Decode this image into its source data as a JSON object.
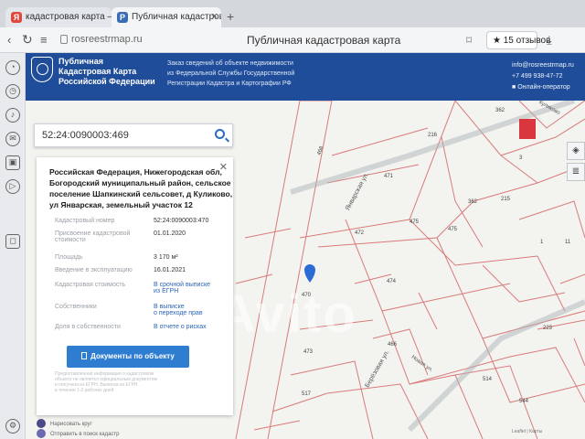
{
  "browser": {
    "tabs": [
      {
        "label": "кадастровая карта — Янде...",
        "favicon": "Я"
      },
      {
        "label": "Публичная кадастровая к...",
        "favicon": "Р"
      }
    ],
    "new_tab": "+",
    "url": "rosreestrmap.ru",
    "page_title": "Публичная кадастровая карта",
    "reviews": "★ 15 отзывов"
  },
  "site": {
    "brand_lines": [
      "Публичная",
      "Кадастровая Карта",
      "Российской Федерации"
    ],
    "description_lines": [
      "Заказ сведений об объекте недвижимости",
      "из Федеральной Службы Государственной",
      "Регистрации Кадастра и Картографии РФ"
    ],
    "email": "info@rosreestrmap.ru",
    "phone": "+7 499 938-47-72",
    "operator": "Онлайн-оператор"
  },
  "search": {
    "value": "52:24:0090003:469"
  },
  "panel": {
    "close": "✕",
    "address_lines": [
      "Российская Федерация, Нижегородская обл,",
      "Богородский муниципальный район, сельское",
      "поселение Шапкинский сельсовет, д Куликово,",
      "ул Январская, земельный участок 12"
    ],
    "rows": [
      {
        "label": "Кадастровый номер",
        "value": "52:24:0090003:470",
        "link": false
      },
      {
        "label": "Присвоение кадастровой",
        "label2": "стоимости",
        "value": "01.01.2020",
        "link": false
      },
      {
        "label": "Площадь",
        "value": "3 170 м²",
        "link": false
      },
      {
        "label": "Введение в эксплуатацию",
        "value": "16.01.2021",
        "link": false
      },
      {
        "label": "Кадастровая стоимость",
        "value": "В срочной выписке",
        "value2": "из ЕГРН",
        "link": true
      },
      {
        "label": "Собственники",
        "value": "В выписке",
        "value2": "о переходе прав",
        "link": true
      },
      {
        "label": "Доля в собственности",
        "value": "В отчете о рисках",
        "link": true
      }
    ],
    "docs_button": "Документы по объекту",
    "note_lines": [
      "Предоставленная информация о кадастровом",
      "объекте не является официальным документом",
      "и получена из ЕГРН. Выписка из ЕГРН",
      "в течение 1-2 рабочих дней"
    ]
  },
  "bottom": {
    "item1": "Нарисовать круг",
    "item2": "Отправить в поиск кадастр"
  },
  "map": {
    "watermark": "Avito",
    "street1": "Январская ул.",
    "street2": "Берёзовая ул.",
    "street3": "Новая ул.",
    "street4": "Куликово",
    "labels": [
      "216",
      "471",
      "475",
      "472",
      "475",
      "474",
      "470",
      "473",
      "466",
      "362",
      "215",
      "1",
      "223",
      "544",
      "517",
      "514",
      "468",
      "362",
      "11",
      "3"
    ],
    "copyright": "Leaflet | Карты"
  }
}
